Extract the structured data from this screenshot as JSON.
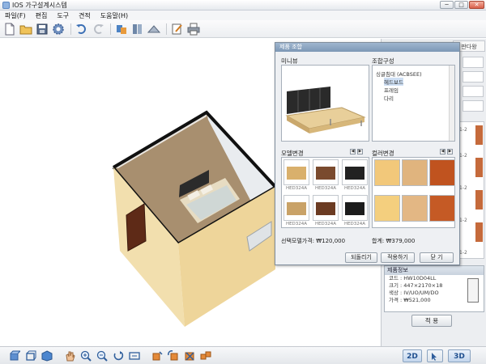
{
  "window": {
    "title": "IOS 가구설계시스템",
    "minimize_label": "─",
    "maximize_label": "□",
    "close_label": "✕"
  },
  "menu": [
    "파일(F)",
    "편집",
    "도구",
    "견적",
    "도움말(H)"
  ],
  "toolbar_icons": [
    "new-file-icon",
    "open-folder-icon",
    "save-icon",
    "settings-gear-icon",
    "undo-icon",
    "redo-icon",
    "furniture-icon",
    "catalog-icon",
    "layout-icon",
    "edit-note-icon",
    "print-icon"
  ],
  "right_panel": {
    "tab_label": "판다왕",
    "product_info": {
      "header": "제품정보",
      "code": "코드 : HW10D04LL",
      "size": "크기 : 447×2170×18",
      "color": "색상 : IV/UO/UM/DO",
      "price": "가격 : ₩521,000"
    },
    "apply_label": "적 용",
    "side_labels": [
      "1-2",
      "1-2",
      "1-2",
      "1-2",
      "1-2"
    ]
  },
  "dialog": {
    "title": "제품 조합",
    "preview_label": "미니뷰",
    "composition_label": "조합구성",
    "tree": {
      "root": "싱글침대 (ACBSEE)",
      "items": [
        "헤드보드",
        "프레임",
        "다리"
      ],
      "selected_index": 0
    },
    "model_change_label": "모델변경",
    "color_change_label": "컬러변경",
    "models": [
      {
        "caption": "HED324A",
        "color": "#d9b06c"
      },
      {
        "caption": "HED324A",
        "color": "#7a4a2e"
      },
      {
        "caption": "HED324A",
        "color": "#222222"
      },
      {
        "caption": "HED324A",
        "color": "#c9a267"
      },
      {
        "caption": "HED324A",
        "color": "#6b3b22"
      },
      {
        "caption": "HED324A",
        "color": "#1c1c1c"
      }
    ],
    "swatches": [
      "#f2c87a",
      "#e0b47e",
      "#c0531f",
      "#f4cf7e",
      "#e3b784",
      "#c55a25"
    ],
    "selected_model_price": "선택모델가격: ₩120,000",
    "total_price": "합계: ₩379,000",
    "buttons": {
      "revert": "되돌리기",
      "apply": "적용하기",
      "close": "닫 기"
    }
  },
  "view_toggles": {
    "two_d": "2D",
    "three_d": "3D"
  },
  "bottom_icons": [
    "view-box-icon",
    "view-cube-icon",
    "view-3d-icon",
    "pan-hand-icon",
    "zoom-in-icon",
    "zoom-out-icon",
    "rotate-icon",
    "fit-view-icon",
    "move-item-icon",
    "rotate-item-icon",
    "delete-item-icon",
    "group-item-icon"
  ],
  "colors": {
    "accent": "#7c97b5",
    "floor": "#a88f6f",
    "wall": "#f2dfae"
  }
}
